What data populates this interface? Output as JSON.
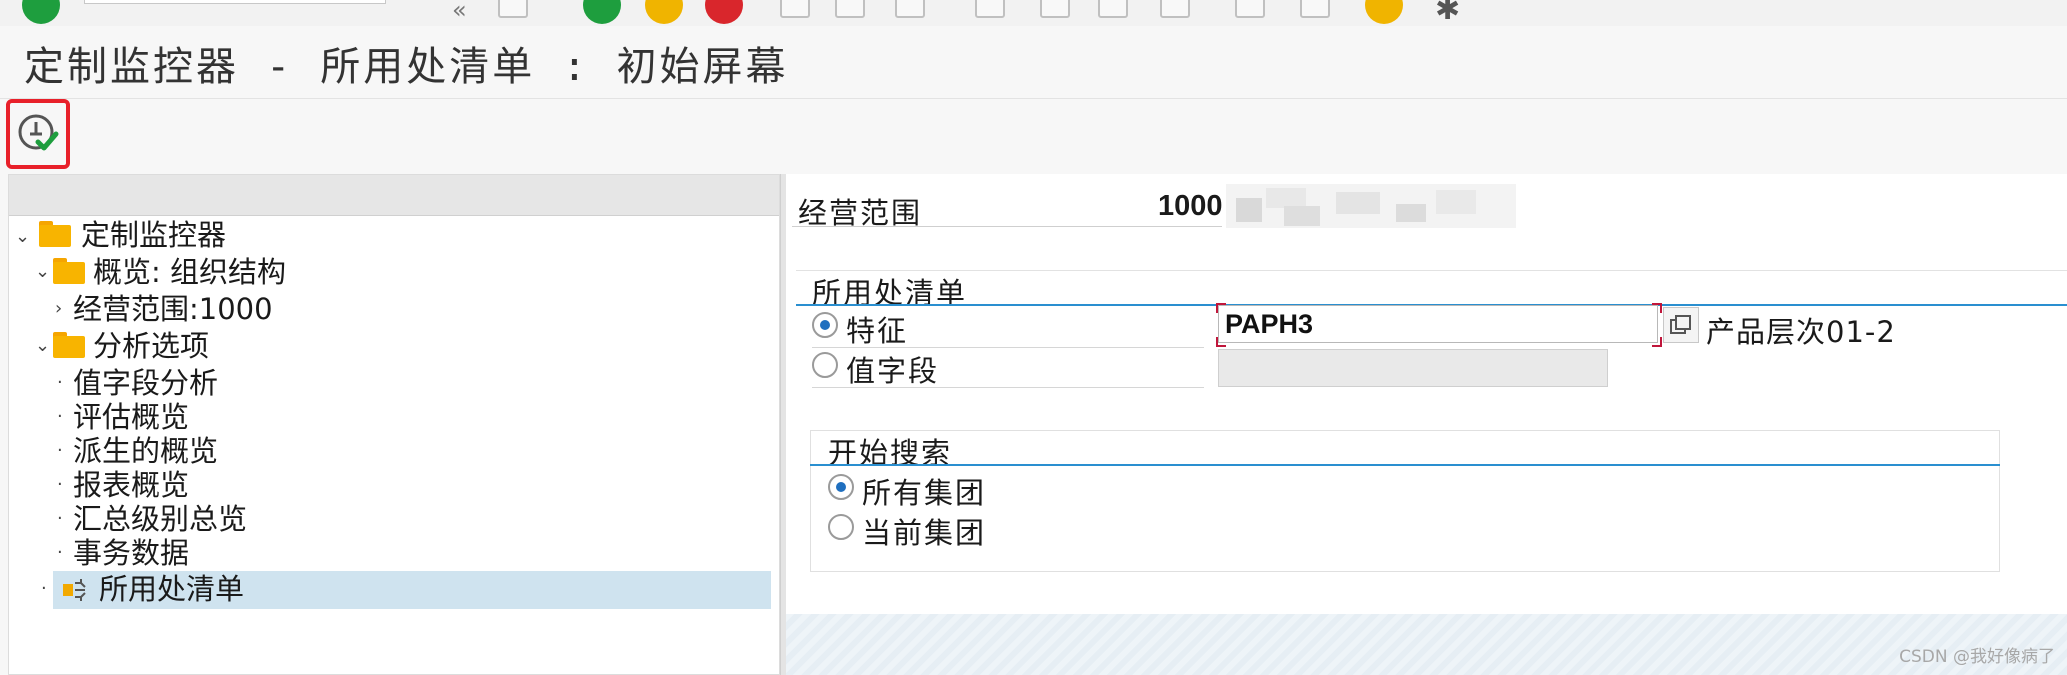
{
  "window": {
    "title": "定制监控器 - 所用处清单 : 初始屏幕"
  },
  "toolbar": {
    "icons": [
      "confirm-icon",
      "command-field",
      "back-icon",
      "save-icon",
      "nav-back-icon",
      "exit-icon",
      "cancel-icon",
      "print-icon",
      "find-icon",
      "find-next-icon",
      "first-page-icon",
      "prev-page-icon",
      "next-page-icon",
      "last-page-icon",
      "create-session-icon",
      "shortcut-icon",
      "help-icon",
      "settings-icon"
    ],
    "execute_tooltip": "执行"
  },
  "tree": {
    "root": "定制监控器",
    "items": [
      {
        "label": "概览: 组织结构",
        "type": "folder",
        "expanded": true
      },
      {
        "label": "经营范围:1000",
        "type": "leaf-collapsed"
      },
      {
        "label": "分析选项",
        "type": "folder",
        "expanded": true
      },
      {
        "label": "值字段分析",
        "type": "leaf"
      },
      {
        "label": "评估概览",
        "type": "leaf"
      },
      {
        "label": "派生的概览",
        "type": "leaf"
      },
      {
        "label": "报表概览",
        "type": "leaf"
      },
      {
        "label": "汇总级别总览",
        "type": "leaf"
      },
      {
        "label": "事务数据",
        "type": "leaf"
      },
      {
        "label": "所用处清单",
        "type": "selected"
      }
    ]
  },
  "form": {
    "operating_concern": {
      "label": "经营范围",
      "value": "1000"
    },
    "where_used": {
      "title": "所用处清单",
      "characteristic_label": "特征",
      "characteristic_value": "PAPH3",
      "characteristic_desc": "产品层次01-2",
      "value_field_label": "值字段",
      "selected": "characteristic"
    },
    "search_start": {
      "title": "开始搜索",
      "all_groups": "所有集团",
      "current_group": "当前集团",
      "selected": "all_groups"
    }
  },
  "watermark": "CSDN @我好像病了",
  "colors": {
    "highlight_box": "#e8202a",
    "group_line": "#2a8fd0",
    "selected_node": "#cfe3ef",
    "folder": "#f8b400"
  }
}
